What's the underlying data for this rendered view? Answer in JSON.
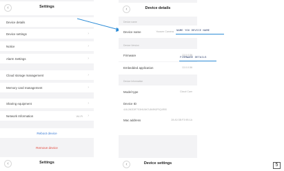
{
  "left": {
    "header": {
      "back_icon": "chevron-left",
      "title": "Settings"
    },
    "items": [
      {
        "label": "Device details"
      },
      {
        "label": "Device settings"
      },
      {
        "label": "Notice"
      },
      {
        "label": "Alarm Settings"
      },
      {
        "label": "Cloud storage management"
      },
      {
        "label": "Memory card management"
      },
      {
        "label": "Sharing equipment"
      },
      {
        "label": "Network Information",
        "value": "Wi-Fi"
      }
    ],
    "reboot_label": "Reboot device",
    "remove_label": "Remove device",
    "footer_title": "Settings"
  },
  "right": {
    "header": {
      "title": "Device details"
    },
    "section_device_name": "Device name",
    "device_name": {
      "label": "Device name",
      "value": "Yoosee Camera"
    },
    "section_device_version": "Device Version",
    "firmware": {
      "label": "Firmware",
      "value": "13.0.0.56"
    },
    "embedded_app": {
      "label": "Embedded application",
      "value": "13.0.0.56"
    },
    "section_device_info": "Device Information",
    "model_type": {
      "label": "Model type",
      "value": "Cloud Cam"
    },
    "device_id": {
      "label": "Device ID",
      "value": "4J4L2M2D3F7G3H5J6K7L8M9N2P3Q4R5S"
    },
    "mac": {
      "label": "Mac address",
      "value": "28:A0:3B:F3:9B:1A"
    },
    "footer_title": "Device settings"
  },
  "annotations": {
    "device_name_note": "NAME YOU DEVICE NAME",
    "firmware_note": "FIRMWARE DETAILS"
  },
  "page_number": "5",
  "colors": {
    "reboot": "#3a7bd5",
    "remove": "#e2483d",
    "arrow": "#2b8bd6"
  }
}
